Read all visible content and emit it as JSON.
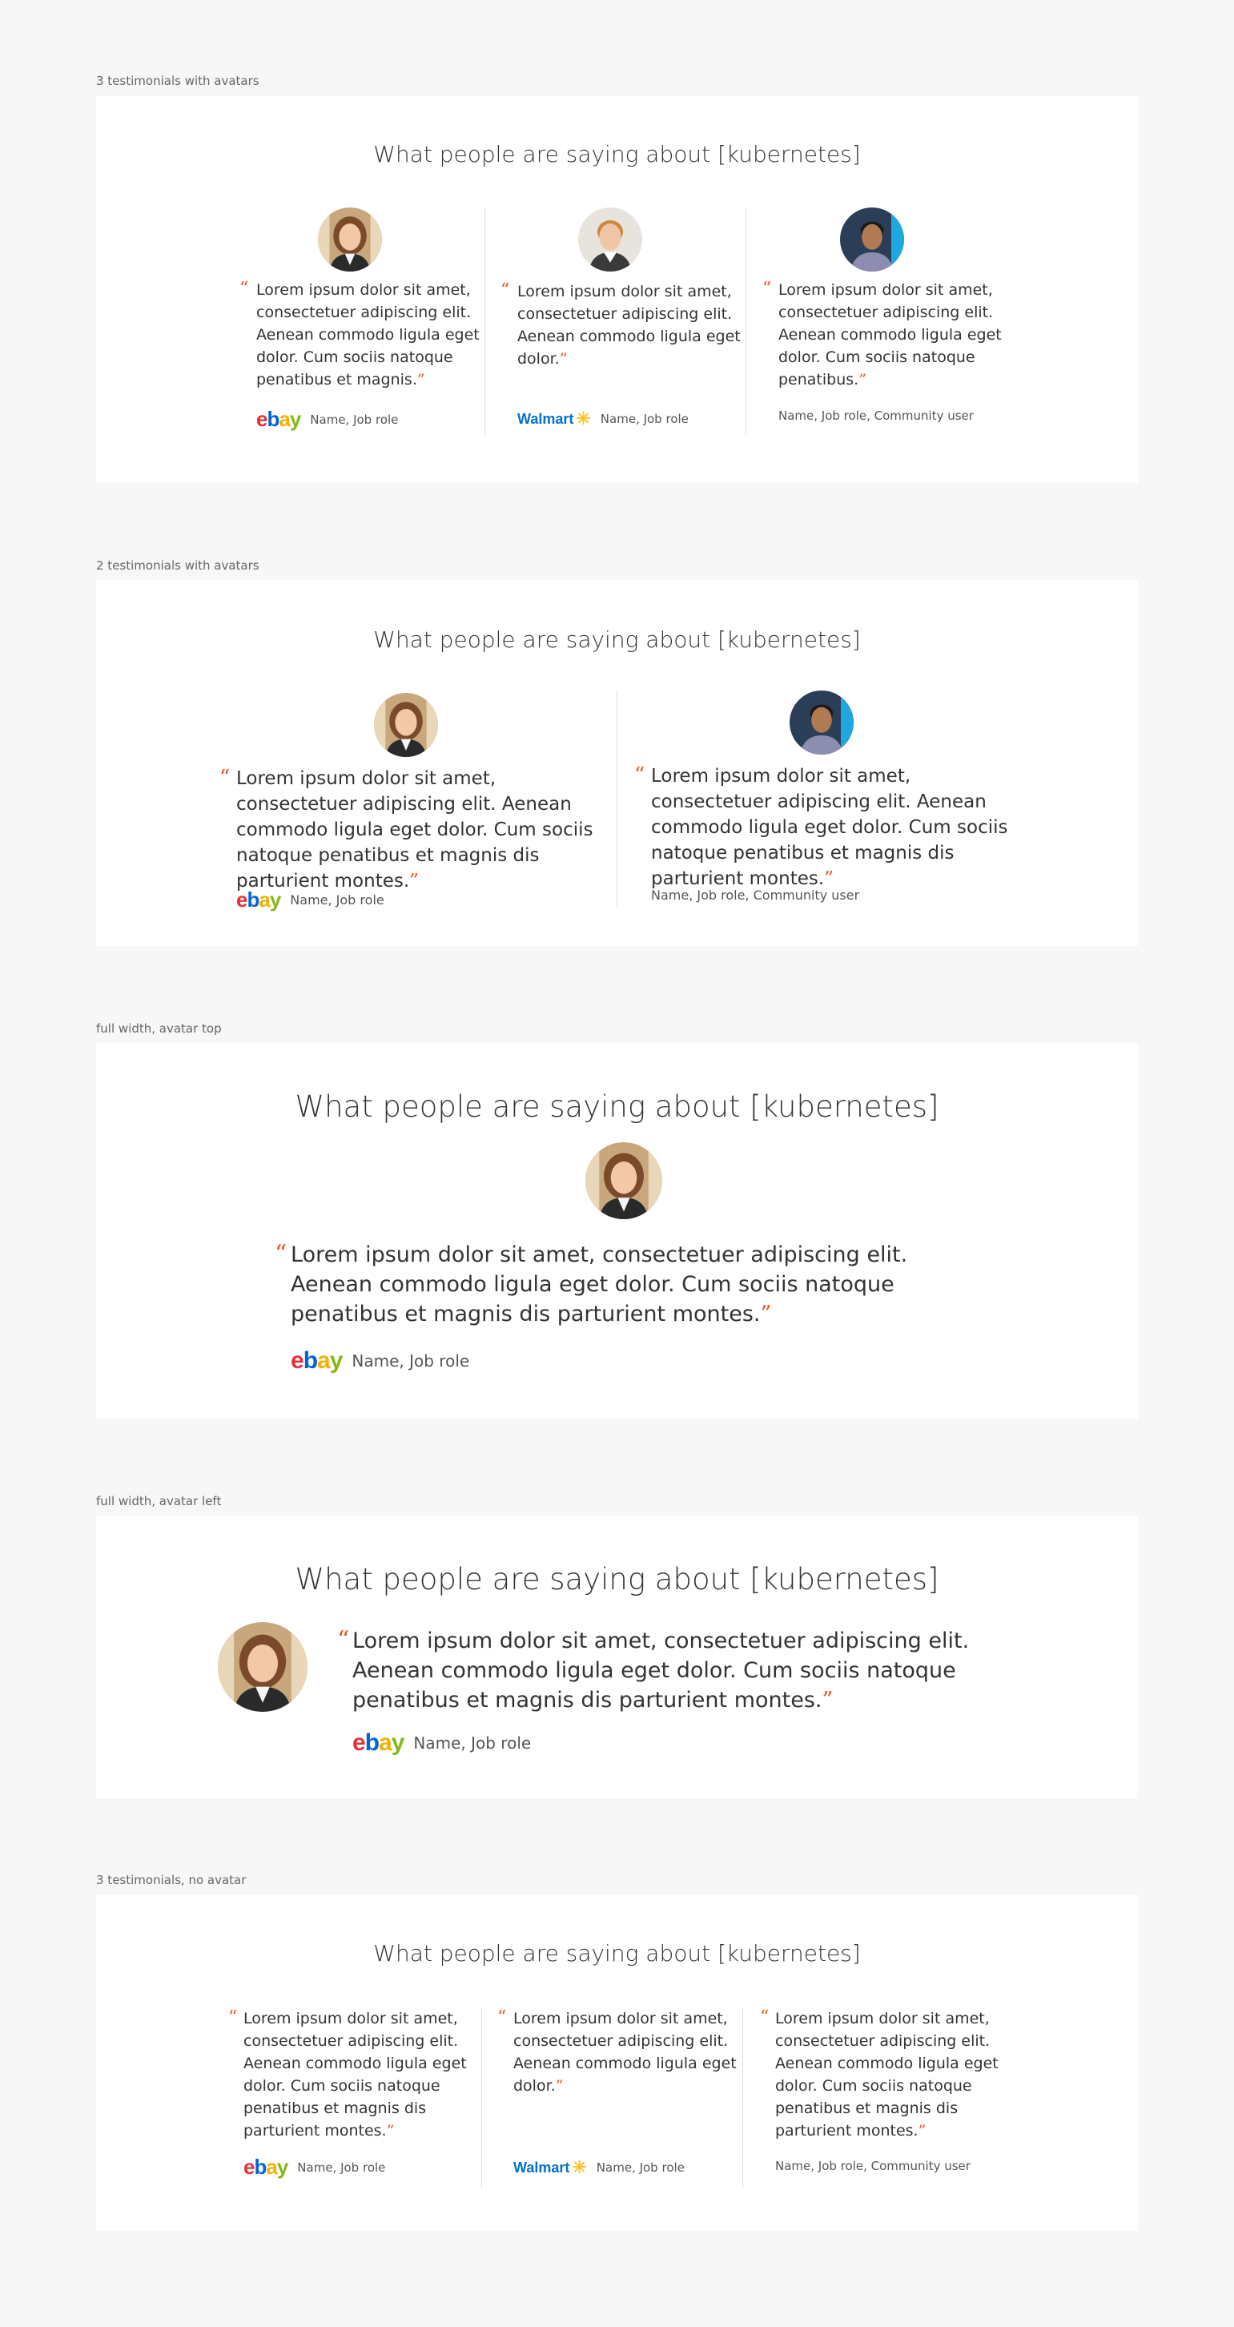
{
  "sections": [
    {
      "label": "3 testimonials with avatars",
      "title": "What people are saying about [kubernetes]",
      "items": [
        {
          "quote": "Lorem ipsum dolor sit amet, consectetuer adipiscing elit. Aenean commodo ligula eget dolor. Cum sociis natoque penatibus et magnis.",
          "logo": "ebay",
          "attribution": "Name, Job role"
        },
        {
          "quote": "Lorem ipsum dolor sit amet, consectetuer adipiscing elit. Aenean commodo ligula eget dolor.",
          "logo": "Walmart",
          "attribution": "Name, Job role"
        },
        {
          "quote": "Lorem ipsum dolor sit amet, consectetuer adipiscing elit. Aenean commodo ligula eget dolor. Cum sociis natoque penatibus.",
          "logo": "",
          "attribution": "Name, Job role, Community user"
        }
      ]
    },
    {
      "label": "2 testimonials with avatars",
      "title": "What people are saying about [kubernetes]",
      "items": [
        {
          "quote": "Lorem ipsum dolor sit amet, consectetuer adipiscing elit. Aenean commodo ligula eget dolor. Cum sociis natoque penatibus et magnis dis parturient montes.",
          "logo": "ebay",
          "attribution": "Name, Job role"
        },
        {
          "quote": "Lorem ipsum dolor sit amet, consectetuer adipiscing elit. Aenean commodo ligula eget dolor. Cum sociis natoque penatibus et magnis dis parturient montes.",
          "logo": "",
          "attribution": "Name, Job role, Community user"
        }
      ]
    },
    {
      "label": "full width, avatar top",
      "title": "What people are saying about [kubernetes]",
      "items": [
        {
          "quote": "Lorem ipsum dolor sit amet, consectetuer adipiscing elit. Aenean commodo ligula eget dolor. Cum sociis natoque penatibus et magnis dis parturient montes.",
          "logo": "ebay",
          "attribution": "Name, Job role"
        }
      ]
    },
    {
      "label": "full width, avatar left",
      "title": "What people are saying about [kubernetes]",
      "items": [
        {
          "quote": "Lorem ipsum dolor sit amet, consectetuer adipiscing elit. Aenean commodo ligula eget dolor. Cum sociis natoque penatibus et magnis dis parturient montes.",
          "logo": "ebay",
          "attribution": "Name, Job role"
        }
      ]
    },
    {
      "label": "3 testimonials, no avatar",
      "title": "What people are saying about [kubernetes]",
      "items": [
        {
          "quote": "Lorem ipsum dolor sit amet, consectetuer adipiscing elit. Aenean commodo ligula eget dolor. Cum sociis natoque penatibus et magnis dis parturient montes.",
          "logo": "ebay",
          "attribution": "Name, Job role"
        },
        {
          "quote": "Lorem ipsum dolor sit amet, consectetuer adipiscing elit. Aenean commodo ligula eget dolor.",
          "logo": "Walmart",
          "attribution": "Name, Job role"
        },
        {
          "quote": "Lorem ipsum dolor sit amet, consectetuer adipiscing elit. Aenean commodo ligula eget dolor. Cum sociis natoque penatibus et magnis dis parturient montes.",
          "logo": "",
          "attribution": "Name, Job role, Community user"
        }
      ]
    }
  ],
  "logos": {
    "ebay": {
      "e": "e",
      "b": "b",
      "a": "a",
      "y": "y"
    },
    "walmart": "Walmart"
  },
  "quote_marks": {
    "open": "“",
    "close": "”"
  },
  "colors": {
    "accent": "#e95420",
    "background": "#f7f7f7",
    "card": "#ffffff",
    "divider": "#dddddd"
  }
}
